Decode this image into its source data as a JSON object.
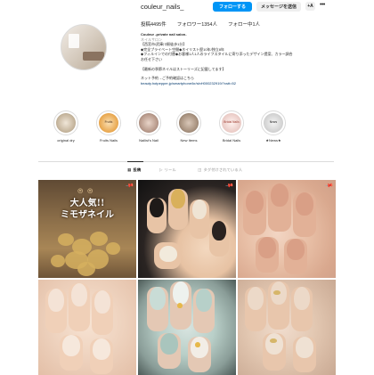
{
  "profile": {
    "username": "couleur_nails_",
    "follow_label": "フォローする",
    "message_label": "メッセージを送信",
    "person_icon_label": "+A",
    "stats": {
      "posts": "投稿4495件",
      "followers": "フォロワー1354人",
      "following": "フォロー中1人"
    },
    "bio": {
      "name": "Couleur -private nail salon-",
      "category": "ネイルサロン",
      "line1": "【西宮市/武庫川駅徒歩1分】",
      "line2": "◆完全プライベート空間◆ネイリスト歴10年/独立8年",
      "line3": "◆フィルインでの付替◆お客様1人1人のライフスタイルに寄り添ったデザイン提案、カラー調合",
      "line4": "お任せ下さい",
      "line5": "【最新の季節ネイルはストーリーズに記載してます】",
      "line6": "ネット予約→ご予約確認はこちら",
      "link": "beauty.hotpepper.jp/smartphone/kr/slnH000232919/?cstt=52"
    }
  },
  "highlights": [
    {
      "label": "original dry",
      "color": "#c7b79f",
      "inner": ""
    },
    {
      "label": "Fruits Nails",
      "color": "#e7a44a",
      "inner": "Fruits"
    },
    {
      "label": "Nailist's Nail",
      "color": "#b99b8c",
      "inner": ""
    },
    {
      "label": "New Items",
      "color": "#a8927f",
      "inner": ""
    },
    {
      "label": "Bridal Nails",
      "color": "#e9c9c4",
      "inner": "Bridal Nails"
    },
    {
      "label": "★News★",
      "color": "#cfcfcf",
      "inner": "News"
    }
  ],
  "tabs": [
    {
      "label": "投稿",
      "icon": "grid-icon",
      "active": true
    },
    {
      "label": "リール",
      "icon": "reels-icon",
      "active": false
    },
    {
      "label": "タグ付けされている人",
      "icon": "tagged-icon",
      "active": false
    }
  ],
  "posts": [
    {
      "caption": "大人気!!\nミモザネイル",
      "pinned": true
    },
    {
      "caption": "",
      "pinned": true
    },
    {
      "caption": "",
      "pinned": true
    },
    {
      "caption": "",
      "pinned": false
    },
    {
      "caption": "",
      "pinned": false
    },
    {
      "caption": "",
      "pinned": false
    }
  ],
  "colors": {
    "accent": "#0095f6",
    "link": "#00376b",
    "muted": "#8e8e8e",
    "border": "#dbdbdb"
  }
}
